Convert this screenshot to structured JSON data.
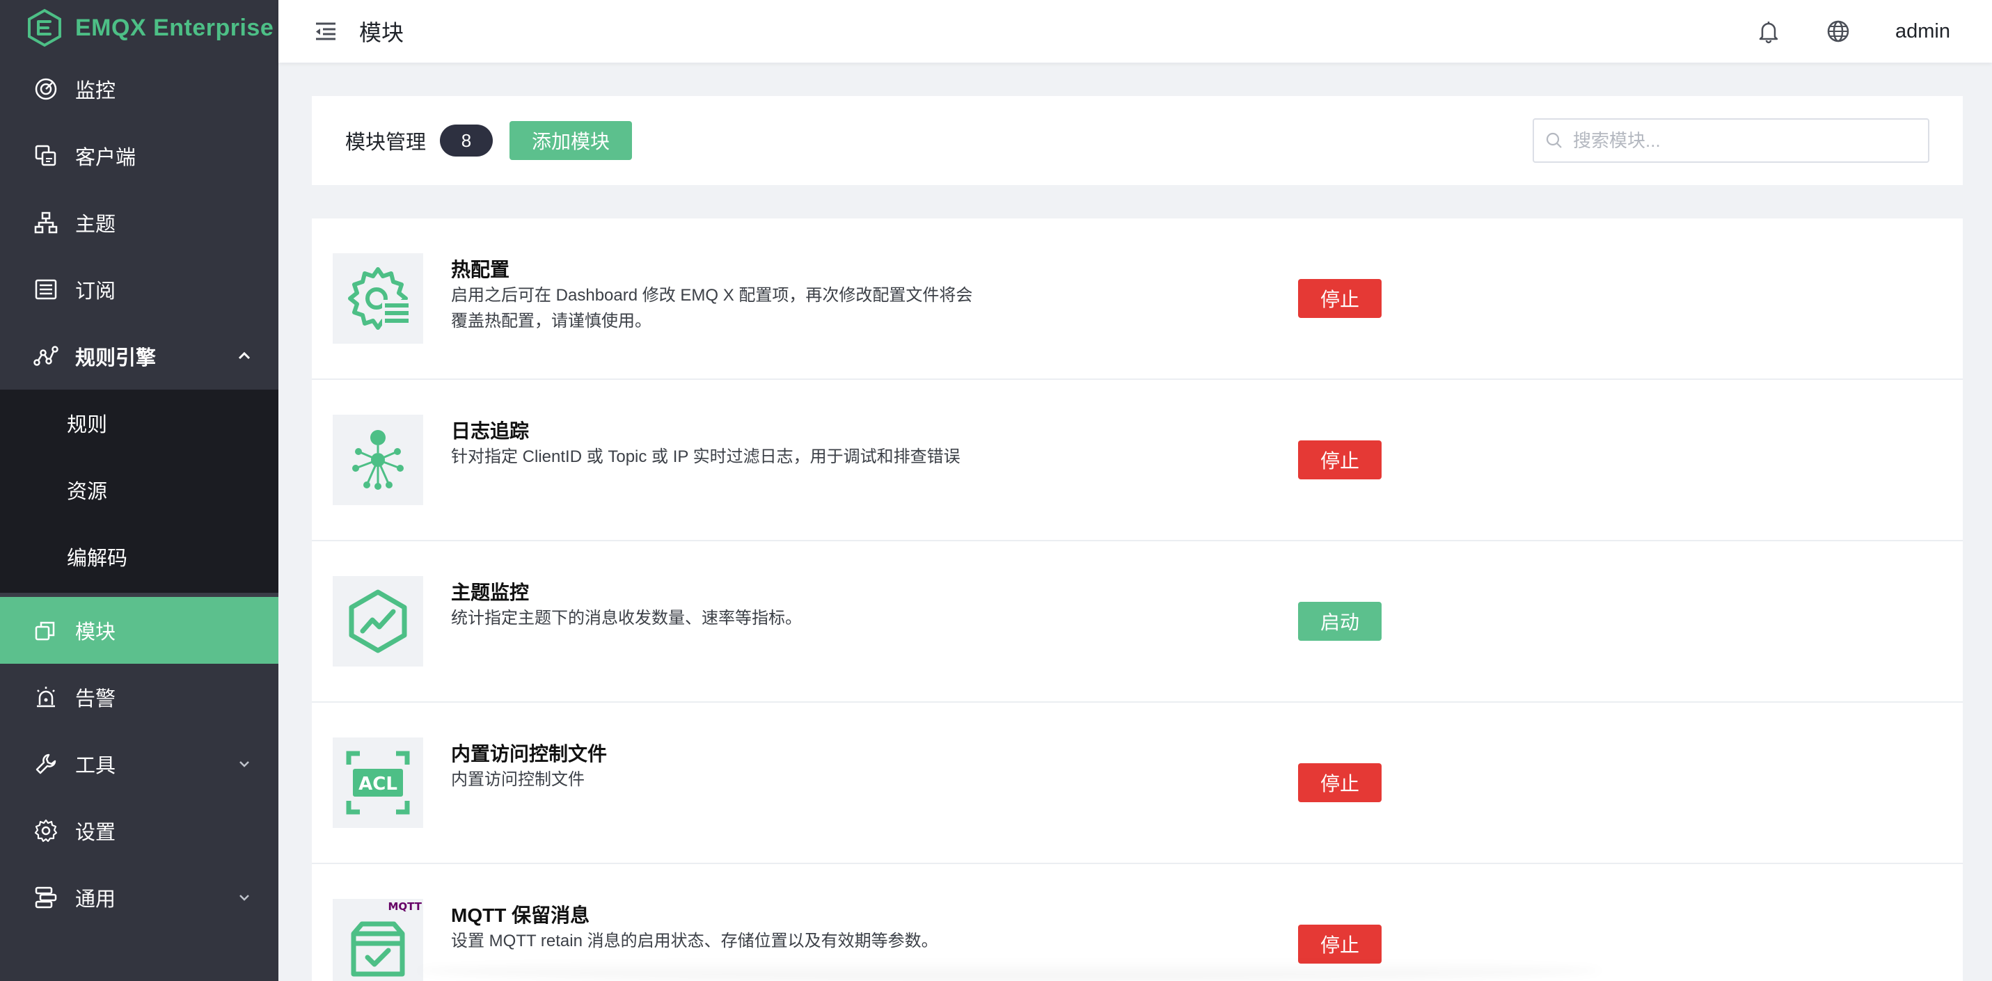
{
  "app": {
    "brand": "EMQX Enterprise"
  },
  "sidebar": {
    "items": [
      {
        "label": "监控",
        "icon": "dashboard-gauge-icon"
      },
      {
        "label": "客户端",
        "icon": "clients-icon"
      },
      {
        "label": "主题",
        "icon": "topic-tree-icon"
      },
      {
        "label": "订阅",
        "icon": "subscriptions-list-icon"
      },
      {
        "label": "规则引擎",
        "icon": "rule-engine-icon",
        "expanded": true
      },
      {
        "label": "模块",
        "icon": "modules-icon",
        "active": true
      },
      {
        "label": "告警",
        "icon": "alarm-icon"
      },
      {
        "label": "工具",
        "icon": "wrench-icon",
        "collapsed": true
      },
      {
        "label": "设置",
        "icon": "gear-icon"
      },
      {
        "label": "通用",
        "icon": "general-icon",
        "collapsed": true
      }
    ],
    "submenu": [
      {
        "label": "规则"
      },
      {
        "label": "资源"
      },
      {
        "label": "编解码"
      }
    ]
  },
  "header": {
    "title": "模块",
    "user": "admin"
  },
  "toolbar": {
    "label": "模块管理",
    "count": "8",
    "add_label": "添加模块",
    "search_placeholder": "搜索模块..."
  },
  "modules": [
    {
      "name": "热配置",
      "desc": "启用之后可在 Dashboard 修改 EMQ X 配置项，再次修改配置文件将会覆盖热配置，请谨慎使用。",
      "action": "停止",
      "icon": "hot-config-gear-icon"
    },
    {
      "name": "日志追踪",
      "desc": "针对指定 ClientID 或 Topic 或 IP 实时过滤日志，用于调试和排查错误",
      "action": "停止",
      "icon": "log-trace-network-icon"
    },
    {
      "name": "主题监控",
      "desc": "统计指定主题下的消息收发数量、速率等指标。",
      "action": "启动",
      "icon": "topic-monitor-hexagon-icon"
    },
    {
      "name": "内置访问控制文件",
      "desc": "内置访问控制文件",
      "action": "停止",
      "icon": "acl-icon",
      "icon_text": "ACL"
    },
    {
      "name": "MQTT 保留消息",
      "desc": "设置 MQTT retain 消息的启用状态、存储位置以及有效期等参数。",
      "action": "停止",
      "icon": "mqtt-retain-box-icon",
      "icon_text": "MQTT"
    }
  ],
  "colors": {
    "sidebar_bg": "#33353f",
    "submenu_bg": "#1b1c22",
    "accent": "#5cc08d",
    "stop": "#e53935",
    "brand_text": "#4dbf86"
  }
}
